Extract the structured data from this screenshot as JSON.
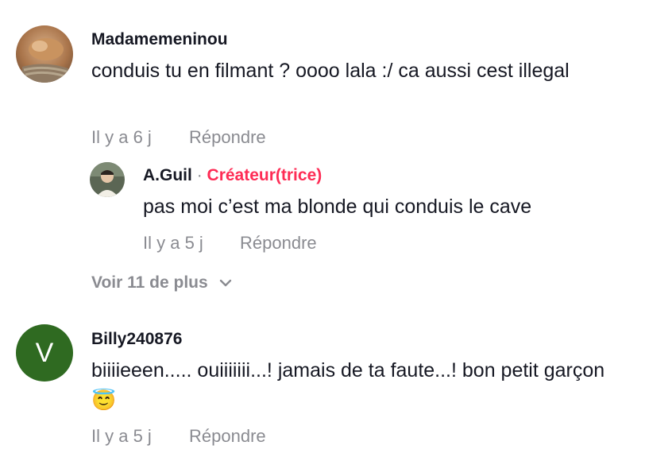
{
  "comments": [
    {
      "username": "Madamemeninou",
      "text": "conduis tu en filmant ? oooo lala :/ ca aussi cest illegal",
      "time": "Il y a 6 j",
      "reply_label": "Répondre",
      "avatar_icon": "cat-photo-avatar",
      "replies": [
        {
          "username": "A.Guil",
          "separator": "·",
          "creator_badge": "Créateur(trice)",
          "text": "pas moi c’est ma blonde qui conduis le cave",
          "time": "Il y a 5 j",
          "reply_label": "Répondre",
          "avatar_icon": "person-photo-avatar"
        }
      ],
      "more_label": "Voir 11 de plus",
      "more_icon": "chevron-down-icon"
    },
    {
      "username": "Billy240876",
      "text": "biiiieeen..... ouiiiiiii...! jamais de ta faute...! bon petit garçon 😇",
      "time": "Il y a 5 j",
      "reply_label": "Répondre",
      "avatar_letter": "V",
      "avatar_color": "#2f6a21"
    }
  ]
}
